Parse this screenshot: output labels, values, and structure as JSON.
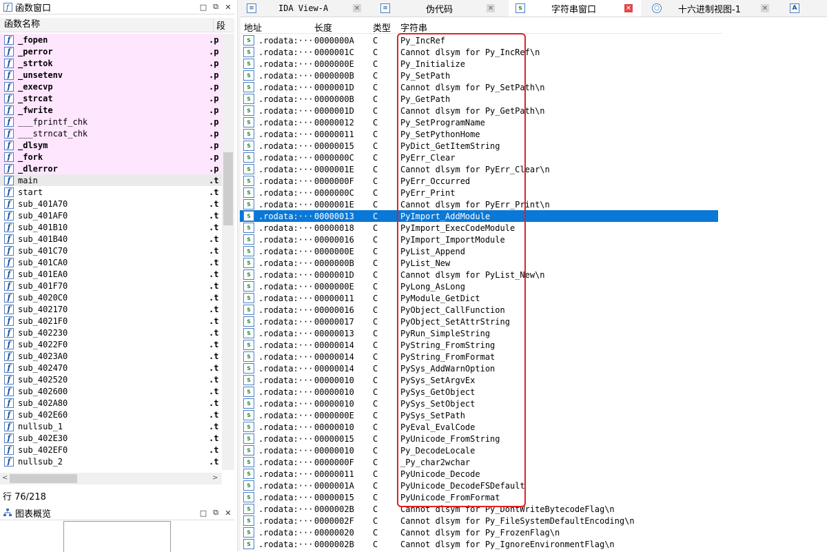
{
  "left_panel": {
    "title": "函数窗口",
    "header": {
      "name": "函数名称",
      "segment": "段"
    },
    "functions": [
      {
        "name": "_fopen",
        "seg": ".p",
        "style": "pink-bold"
      },
      {
        "name": "_perror",
        "seg": ".p",
        "style": "pink-bold"
      },
      {
        "name": "_strtok",
        "seg": ".p",
        "style": "pink-bold"
      },
      {
        "name": "_unsetenv",
        "seg": ".p",
        "style": "pink-bold"
      },
      {
        "name": "_execvp",
        "seg": ".p",
        "style": "pink-bold"
      },
      {
        "name": "_strcat",
        "seg": ".p",
        "style": "pink-bold"
      },
      {
        "name": "_fwrite",
        "seg": ".p",
        "style": "pink-bold"
      },
      {
        "name": "___fprintf_chk",
        "seg": ".p",
        "style": "pink"
      },
      {
        "name": "___strncat_chk",
        "seg": ".p",
        "style": "pink"
      },
      {
        "name": "_dlsym",
        "seg": ".p",
        "style": "pink-bold"
      },
      {
        "name": "_fork",
        "seg": ".p",
        "style": "pink-bold"
      },
      {
        "name": "_dlerror",
        "seg": ".p",
        "style": "pink-bold"
      },
      {
        "name": "main",
        "seg": ".t",
        "style": "selected"
      },
      {
        "name": "start",
        "seg": ".t",
        "style": "normal"
      },
      {
        "name": "sub_401A70",
        "seg": ".t",
        "style": "normal"
      },
      {
        "name": "sub_401AF0",
        "seg": ".t",
        "style": "normal"
      },
      {
        "name": "sub_401B10",
        "seg": ".t",
        "style": "normal"
      },
      {
        "name": "sub_401B40",
        "seg": ".t",
        "style": "normal"
      },
      {
        "name": "sub_401C70",
        "seg": ".t",
        "style": "normal"
      },
      {
        "name": "sub_401CA0",
        "seg": ".t",
        "style": "normal"
      },
      {
        "name": "sub_401EA0",
        "seg": ".t",
        "style": "normal"
      },
      {
        "name": "sub_401F70",
        "seg": ".t",
        "style": "normal"
      },
      {
        "name": "sub_4020C0",
        "seg": ".t",
        "style": "normal"
      },
      {
        "name": "sub_402170",
        "seg": ".t",
        "style": "normal"
      },
      {
        "name": "sub_4021F0",
        "seg": ".t",
        "style": "normal"
      },
      {
        "name": "sub_402230",
        "seg": ".t",
        "style": "normal"
      },
      {
        "name": "sub_4022F0",
        "seg": ".t",
        "style": "normal"
      },
      {
        "name": "sub_4023A0",
        "seg": ".t",
        "style": "normal"
      },
      {
        "name": "sub_402470",
        "seg": ".t",
        "style": "normal"
      },
      {
        "name": "sub_402520",
        "seg": ".t",
        "style": "normal"
      },
      {
        "name": "sub_402600",
        "seg": ".t",
        "style": "normal"
      },
      {
        "name": "sub_402A80",
        "seg": ".t",
        "style": "normal"
      },
      {
        "name": "sub_402E60",
        "seg": ".t",
        "style": "normal"
      },
      {
        "name": "nullsub_1",
        "seg": ".t",
        "style": "normal"
      },
      {
        "name": "sub_402E30",
        "seg": ".t",
        "style": "normal"
      },
      {
        "name": "sub_402EF0",
        "seg": ".t",
        "style": "normal"
      },
      {
        "name": "nullsub_2",
        "seg": ".t",
        "style": "normal"
      }
    ],
    "status": "行 76/218",
    "overview_title": "图表概览"
  },
  "tabs": [
    {
      "label": "IDA View-A",
      "active": false
    },
    {
      "label": "伪代码",
      "active": false
    },
    {
      "label": "字符串窗口",
      "active": true
    },
    {
      "label": "十六进制视图-1",
      "active": false
    }
  ],
  "strings_window": {
    "headers": {
      "address": "地址",
      "length": "长度",
      "type": "类型",
      "string": "字符串"
    },
    "rows": [
      {
        "addr": ".rodata:···",
        "len": "0000000A",
        "type": "C",
        "str": "Py_IncRef"
      },
      {
        "addr": ".rodata:···",
        "len": "0000001C",
        "type": "C",
        "str": "Cannot dlsym for Py_IncRef\\n"
      },
      {
        "addr": ".rodata:···",
        "len": "0000000E",
        "type": "C",
        "str": "Py_Initialize"
      },
      {
        "addr": ".rodata:···",
        "len": "0000000B",
        "type": "C",
        "str": "Py_SetPath"
      },
      {
        "addr": ".rodata:···",
        "len": "0000001D",
        "type": "C",
        "str": "Cannot dlsym for Py_SetPath\\n"
      },
      {
        "addr": ".rodata:···",
        "len": "0000000B",
        "type": "C",
        "str": "Py_GetPath"
      },
      {
        "addr": ".rodata:···",
        "len": "0000001D",
        "type": "C",
        "str": "Cannot dlsym for Py_GetPath\\n"
      },
      {
        "addr": ".rodata:···",
        "len": "00000012",
        "type": "C",
        "str": "Py_SetProgramName"
      },
      {
        "addr": ".rodata:···",
        "len": "00000011",
        "type": "C",
        "str": "Py_SetPythonHome"
      },
      {
        "addr": ".rodata:···",
        "len": "00000015",
        "type": "C",
        "str": "PyDict_GetItemString"
      },
      {
        "addr": ".rodata:···",
        "len": "0000000C",
        "type": "C",
        "str": "PyErr_Clear"
      },
      {
        "addr": ".rodata:···",
        "len": "0000001E",
        "type": "C",
        "str": "Cannot dlsym for PyErr_Clear\\n"
      },
      {
        "addr": ".rodata:···",
        "len": "0000000F",
        "type": "C",
        "str": "PyErr_Occurred"
      },
      {
        "addr": ".rodata:···",
        "len": "0000000C",
        "type": "C",
        "str": "PyErr_Print"
      },
      {
        "addr": ".rodata:···",
        "len": "0000001E",
        "type": "C",
        "str": "Cannot dlsym for PyErr_Print\\n"
      },
      {
        "addr": ".rodata:···",
        "len": "00000013",
        "type": "C",
        "str": "PyImport_AddModule",
        "selected": true
      },
      {
        "addr": ".rodata:···",
        "len": "00000018",
        "type": "C",
        "str": "PyImport_ExecCodeModule"
      },
      {
        "addr": ".rodata:···",
        "len": "00000016",
        "type": "C",
        "str": "PyImport_ImportModule"
      },
      {
        "addr": ".rodata:···",
        "len": "0000000E",
        "type": "C",
        "str": "PyList_Append"
      },
      {
        "addr": ".rodata:···",
        "len": "0000000B",
        "type": "C",
        "str": "PyList_New"
      },
      {
        "addr": ".rodata:···",
        "len": "0000001D",
        "type": "C",
        "str": "Cannot dlsym for PyList_New\\n"
      },
      {
        "addr": ".rodata:···",
        "len": "0000000E",
        "type": "C",
        "str": "PyLong_AsLong"
      },
      {
        "addr": ".rodata:···",
        "len": "00000011",
        "type": "C",
        "str": "PyModule_GetDict"
      },
      {
        "addr": ".rodata:···",
        "len": "00000016",
        "type": "C",
        "str": "PyObject_CallFunction"
      },
      {
        "addr": ".rodata:···",
        "len": "00000017",
        "type": "C",
        "str": "PyObject_SetAttrString"
      },
      {
        "addr": ".rodata:···",
        "len": "00000013",
        "type": "C",
        "str": "PyRun_SimpleString"
      },
      {
        "addr": ".rodata:···",
        "len": "00000014",
        "type": "C",
        "str": "PyString_FromString"
      },
      {
        "addr": ".rodata:···",
        "len": "00000014",
        "type": "C",
        "str": "PyString_FromFormat"
      },
      {
        "addr": ".rodata:···",
        "len": "00000014",
        "type": "C",
        "str": "PySys_AddWarnOption"
      },
      {
        "addr": ".rodata:···",
        "len": "00000010",
        "type": "C",
        "str": "PySys_SetArgvEx"
      },
      {
        "addr": ".rodata:···",
        "len": "00000010",
        "type": "C",
        "str": "PySys_GetObject"
      },
      {
        "addr": ".rodata:···",
        "len": "00000010",
        "type": "C",
        "str": "PySys_SetObject"
      },
      {
        "addr": ".rodata:···",
        "len": "0000000E",
        "type": "C",
        "str": "PySys_SetPath"
      },
      {
        "addr": ".rodata:···",
        "len": "00000010",
        "type": "C",
        "str": "PyEval_EvalCode"
      },
      {
        "addr": ".rodata:···",
        "len": "00000015",
        "type": "C",
        "str": "PyUnicode_FromString"
      },
      {
        "addr": ".rodata:···",
        "len": "00000010",
        "type": "C",
        "str": "Py_DecodeLocale"
      },
      {
        "addr": ".rodata:···",
        "len": "0000000F",
        "type": "C",
        "str": "_Py_char2wchar"
      },
      {
        "addr": ".rodata:···",
        "len": "00000011",
        "type": "C",
        "str": "PyUnicode_Decode"
      },
      {
        "addr": ".rodata:···",
        "len": "0000001A",
        "type": "C",
        "str": "PyUnicode_DecodeFSDefault"
      },
      {
        "addr": ".rodata:···",
        "len": "00000015",
        "type": "C",
        "str": "PyUnicode_FromFormat"
      },
      {
        "addr": ".rodata:···",
        "len": "0000002B",
        "type": "C",
        "str": "Cannot dlsym for Py_DontWriteBytecodeFlag\\n"
      },
      {
        "addr": ".rodata:···",
        "len": "0000002F",
        "type": "C",
        "str": "Cannot dlsym for Py_FileSystemDefaultEncoding\\n"
      },
      {
        "addr": ".rodata:···",
        "len": "00000020",
        "type": "C",
        "str": "Cannot dlsym for Py_FrozenFlag\\n"
      },
      {
        "addr": ".rodata:···",
        "len": "0000002B",
        "type": "C",
        "str": "Cannot dlsym for Py_IgnoreEnvironmentFlag\\n"
      }
    ]
  },
  "colors": {
    "selection": "#0a78d7",
    "import_highlight": "#ffe6ff",
    "annotation_box": "#e02020"
  },
  "icons": {
    "function": "f",
    "string": "s",
    "tab_text": "A"
  }
}
